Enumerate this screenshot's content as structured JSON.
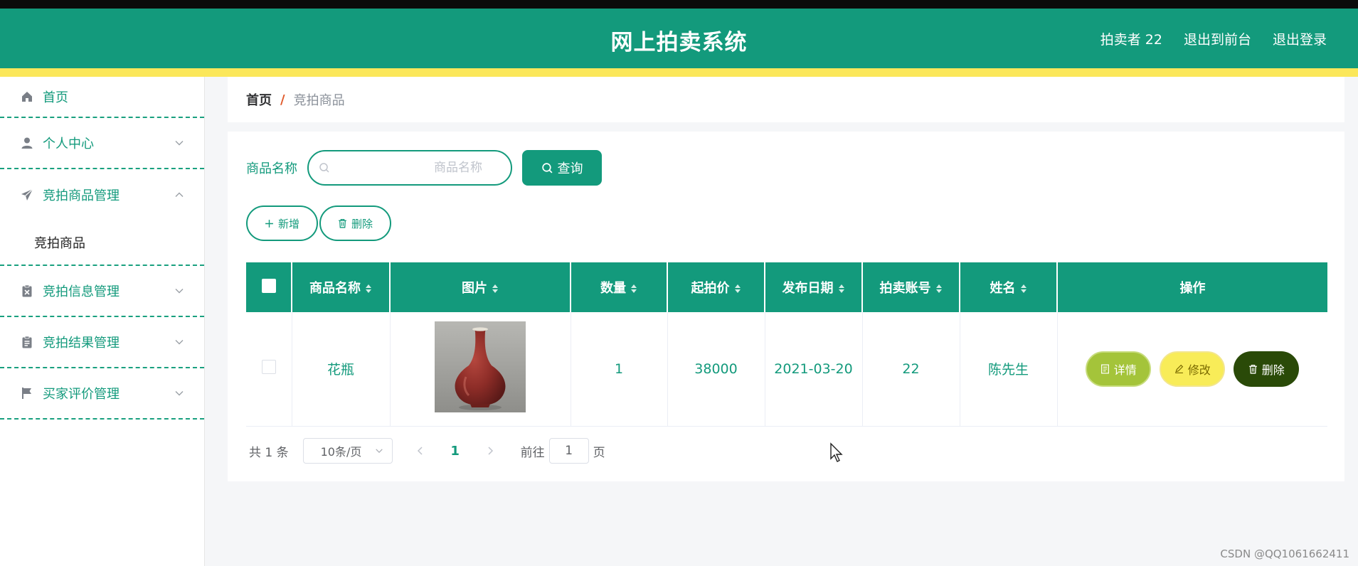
{
  "header": {
    "title": "网上拍卖系统",
    "user": "拍卖者 22",
    "to_front": "退出到前台",
    "logout": "退出登录"
  },
  "colors": {
    "primary": "#139a7c",
    "accent_bar": "#fbe75a"
  },
  "sidebar": {
    "items": [
      {
        "label": "首页",
        "icon": "home-icon"
      },
      {
        "label": "个人中心",
        "icon": "user-icon",
        "expanded": false
      },
      {
        "label": "竞拍商品管理",
        "icon": "send-icon",
        "expanded": true,
        "children": [
          "竞拍商品"
        ]
      },
      {
        "label": "竞拍信息管理",
        "icon": "clipboard-x-icon",
        "expanded": false
      },
      {
        "label": "竞拍结果管理",
        "icon": "clipboard-icon",
        "expanded": false
      },
      {
        "label": "买家评价管理",
        "icon": "flag-icon",
        "expanded": false
      }
    ]
  },
  "breadcrumb": {
    "home": "首页",
    "separator": "/",
    "current": "竞拍商品"
  },
  "search": {
    "label": "商品名称",
    "placeholder": "商品名称",
    "value": "",
    "button": "查询"
  },
  "actions": {
    "add": "新增",
    "delete": "删除"
  },
  "table": {
    "headers": [
      "商品名称",
      "图片",
      "数量",
      "起拍价",
      "发布日期",
      "拍卖账号",
      "姓名",
      "操作"
    ],
    "rows": [
      {
        "name": "花瓶",
        "image": "vase",
        "quantity": "1",
        "start_price": "38000",
        "date": "2021-03-20",
        "account": "22",
        "person": "陈先生",
        "ops": {
          "detail": "详情",
          "edit": "修改",
          "delete": "删除"
        }
      }
    ]
  },
  "pagination": {
    "total": "共 1 条",
    "page_size": "10条/页",
    "current": "1",
    "goto": "前往",
    "jump_value": "1",
    "unit": "页"
  },
  "watermark": "CSDN @QQ1061662411"
}
